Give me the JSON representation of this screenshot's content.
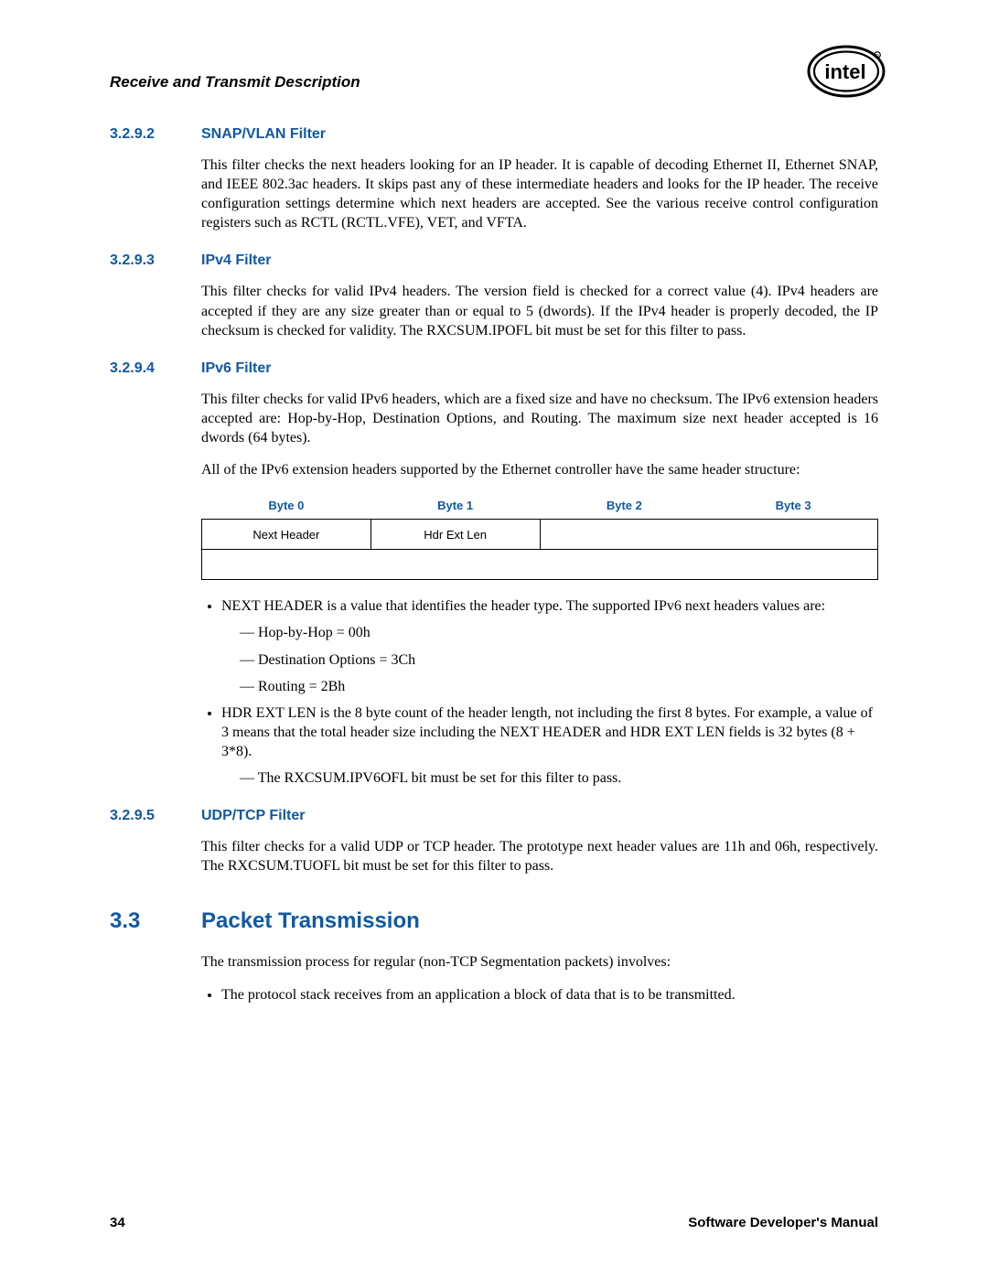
{
  "header": {
    "title": "Receive and Transmit Description",
    "logo_alt": "intel"
  },
  "sections": {
    "s3292": {
      "num": "3.2.9.2",
      "title": "SNAP/VLAN Filter",
      "para1": "This filter checks the next headers looking for an IP header. It is capable of decoding Ethernet II, Ethernet SNAP, and IEEE 802.3ac headers. It skips past any of these intermediate headers and looks for the IP header. The receive configuration settings determine which next headers are accepted. See the various receive control configuration registers such as RCTL (RCTL.VFE), VET, and VFTA."
    },
    "s3293": {
      "num": "3.2.9.3",
      "title": "IPv4 Filter",
      "para1": "This filter checks for valid IPv4 headers. The version field is checked for a correct value (4). IPv4 headers are accepted if they are any size greater than or equal to 5 (dwords). If the IPv4 header is properly decoded, the IP checksum is checked for validity. The RXCSUM.IPOFL bit must be set for this filter to pass."
    },
    "s3294": {
      "num": "3.2.9.4",
      "title": "IPv6 Filter",
      "para1": "This filter checks for valid IPv6 headers, which are a fixed size and have no checksum. The IPv6 extension headers accepted are: Hop-by-Hop, Destination Options, and Routing. The maximum size next header accepted is 16 dwords (64 bytes).",
      "para2": "All of the IPv6 extension headers supported by the Ethernet controller have the same header structure:",
      "table": {
        "headers": [
          "Byte 0",
          "Byte 1",
          "Byte 2",
          "Byte 3"
        ],
        "row1": [
          "Next Header",
          "Hdr Ext Len",
          "",
          ""
        ]
      },
      "bullet1": "NEXT HEADER is a value that identifies the header type. The supported IPv6 next headers values are:",
      "dashes1": [
        "Hop-by-Hop = 00h",
        "Destination Options = 3Ch",
        "Routing = 2Bh"
      ],
      "bullet2": "HDR EXT LEN is the 8 byte count of the header length, not including the first 8 bytes. For example, a value of 3 means that the total header size including the NEXT HEADER and HDR EXT LEN fields is 32 bytes (8 + 3*8).",
      "dashes2": [
        "The RXCSUM.IPV6OFL bit must be set for this filter to pass."
      ]
    },
    "s3295": {
      "num": "3.2.9.5",
      "title": "UDP/TCP Filter",
      "para1": "This filter checks for a valid UDP or TCP header. The prototype next header values are 11h and 06h, respectively. The RXCSUM.TUOFL bit must be set for this filter to pass."
    },
    "s33": {
      "num": "3.3",
      "title": "Packet Transmission",
      "para1": "The transmission process for regular (non-TCP Segmentation packets) involves:",
      "bullet1": "The protocol stack receives from an application a block of data that is to be transmitted."
    }
  },
  "footer": {
    "page": "34",
    "doc": "Software Developer's Manual"
  }
}
